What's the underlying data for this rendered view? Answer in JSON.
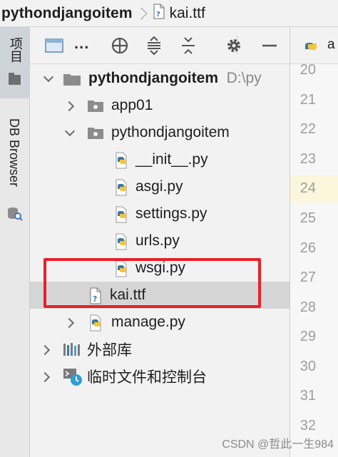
{
  "breadcrumb": {
    "project": "pythondjangoitem",
    "file": "kai.ttf"
  },
  "stripe": {
    "project_label": "项目",
    "db_label": "DB Browser"
  },
  "toolbar": {
    "dots": "..."
  },
  "tree": {
    "root": {
      "name": "pythondjangoitem",
      "path": "D:\\py"
    },
    "app01": "app01",
    "pkg": "pythondjangoitem",
    "files": [
      "__init__.py",
      "asgi.py",
      "settings.py",
      "urls.py",
      "wsgi.py"
    ],
    "kai": "kai.ttf",
    "manage": "manage.py",
    "external": "外部库",
    "scratches": "临时文件和控制台"
  },
  "editor": {
    "tab_label": "a",
    "line_numbers": [
      "20",
      "21",
      "22",
      "23",
      "24",
      "25",
      "26",
      "27",
      "28",
      "29",
      "30",
      "31",
      "32"
    ]
  },
  "watermark": "CSDN @哲此一生984",
  "colors": {
    "highlight": "#e8202a",
    "selected": "#d5d5d5",
    "python_blue": "#3b77a8",
    "python_yellow": "#f2c53d"
  }
}
